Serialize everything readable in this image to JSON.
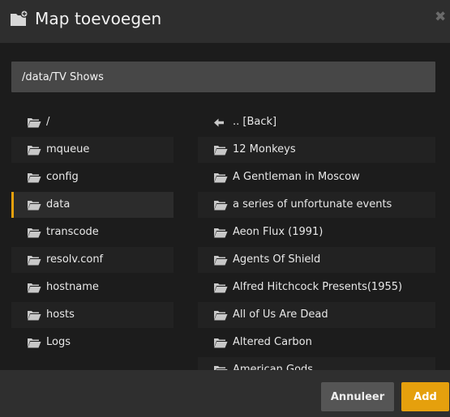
{
  "dialog": {
    "title": "Map toevoegen",
    "header_icon": "folder-add-icon",
    "close_icon": "close-icon",
    "close_glyph": "✖"
  },
  "path_input": {
    "value": "/data/TV Shows"
  },
  "left_list": [
    {
      "label": "/",
      "selected": false
    },
    {
      "label": "mqueue",
      "selected": false
    },
    {
      "label": "config",
      "selected": false
    },
    {
      "label": "data",
      "selected": true
    },
    {
      "label": "transcode",
      "selected": false
    },
    {
      "label": "resolv.conf",
      "selected": false
    },
    {
      "label": "hostname",
      "selected": false
    },
    {
      "label": "hosts",
      "selected": false
    },
    {
      "label": "Logs",
      "selected": false
    }
  ],
  "right_list": [
    {
      "label": ".. [Back]",
      "icon": "back-arrow-icon"
    },
    {
      "label": "12 Monkeys",
      "icon": "folder-icon"
    },
    {
      "label": "A Gentleman in Moscow",
      "icon": "folder-icon"
    },
    {
      "label": "a series of unfortunate events",
      "icon": "folder-icon"
    },
    {
      "label": "Aeon Flux (1991)",
      "icon": "folder-icon"
    },
    {
      "label": "Agents Of Shield",
      "icon": "folder-icon"
    },
    {
      "label": "Alfred Hitchcock Presents(1955)",
      "icon": "folder-icon"
    },
    {
      "label": "All of Us Are Dead",
      "icon": "folder-icon"
    },
    {
      "label": "Altered Carbon",
      "icon": "folder-icon"
    },
    {
      "label": "American Gods",
      "icon": "folder-icon"
    }
  ],
  "footer": {
    "cancel_label": "Annuleer",
    "add_label": "Add"
  },
  "colors": {
    "accent": "#e5a00d",
    "background": "#1c1c1c",
    "header": "#2e2e2e",
    "input": "#474747"
  }
}
